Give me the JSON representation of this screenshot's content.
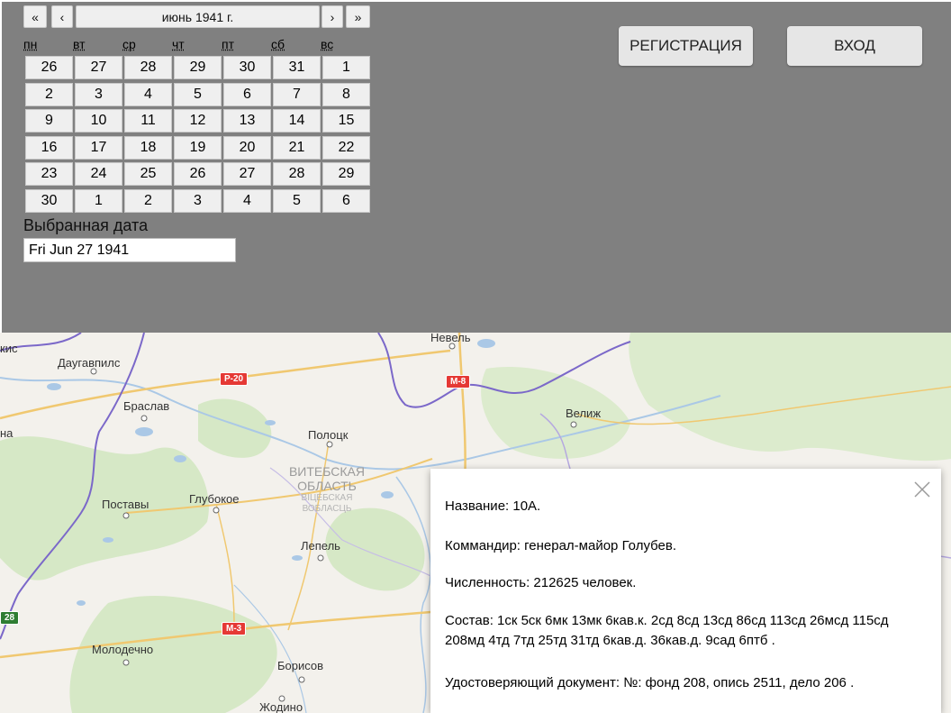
{
  "calendar": {
    "nav": {
      "prev_year": "«",
      "prev_month": "‹",
      "title": "июнь 1941 г.",
      "next_month": "›",
      "next_year": "»"
    },
    "weekdays": [
      "пн",
      "вт",
      "ср",
      "чт",
      "пт",
      "сб",
      "вс"
    ],
    "weeks": [
      [
        "26",
        "27",
        "28",
        "29",
        "30",
        "31",
        "1"
      ],
      [
        "2",
        "3",
        "4",
        "5",
        "6",
        "7",
        "8"
      ],
      [
        "9",
        "10",
        "11",
        "12",
        "13",
        "14",
        "15"
      ],
      [
        "16",
        "17",
        "18",
        "19",
        "20",
        "21",
        "22"
      ],
      [
        "23",
        "24",
        "25",
        "26",
        "27",
        "28",
        "29"
      ],
      [
        "30",
        "1",
        "2",
        "3",
        "4",
        "5",
        "6"
      ]
    ]
  },
  "selected": {
    "label": "Выбранная дата",
    "value": "Fri Jun 27 1941"
  },
  "buttons": {
    "register": "РЕГИСТРАЦИЯ",
    "login": "ВХОД"
  },
  "map": {
    "labels": {
      "daugavpils": "Даугавпилс",
      "braslav": "Браслав",
      "postavy": "Поставы",
      "glubokoe": "Глубокое",
      "polotsk": "Полоцк",
      "nevel": "Невель",
      "velizh": "Велиж",
      "lepel": "Лепель",
      "molodechno": "Молодечно",
      "borisov": "Борисов",
      "zhodino": "Жодино",
      "kis": "кис",
      "na": "на",
      "region_ru_1": "ВИТЕБСКАЯ",
      "region_ru_2": "ОБЛАСТЬ",
      "region_by_1": "ВІЦЕБСКАЯ",
      "region_by_2": "ВОБЛАСЦЬ"
    },
    "roads": {
      "r20": "Р-20",
      "m8": "М-8",
      "m3": "М-3",
      "r28": "28"
    },
    "colors": {
      "water": "#aac8e6",
      "forest": "#d6e8c6",
      "border": "#7b68c9",
      "road": "#f0c870"
    }
  },
  "popup": {
    "name": "Название: 10А.",
    "commander": "Коммандир: генерал-майор Голубев.",
    "strength": "Численность: 212625 человек.",
    "composition": "Состав: 1ск 5ск 6мк 13мк 6кав.к. 2сд 8сд 13сд 86сд 113сд 26мсд 115сд 208мд 4тд 7тд 25тд 31тд 6кав.д. 36кав.д. 9сад 6птб .",
    "document": "Удостоверяющий документ: №: фонд 208, опись 2511, дело 206 ."
  }
}
